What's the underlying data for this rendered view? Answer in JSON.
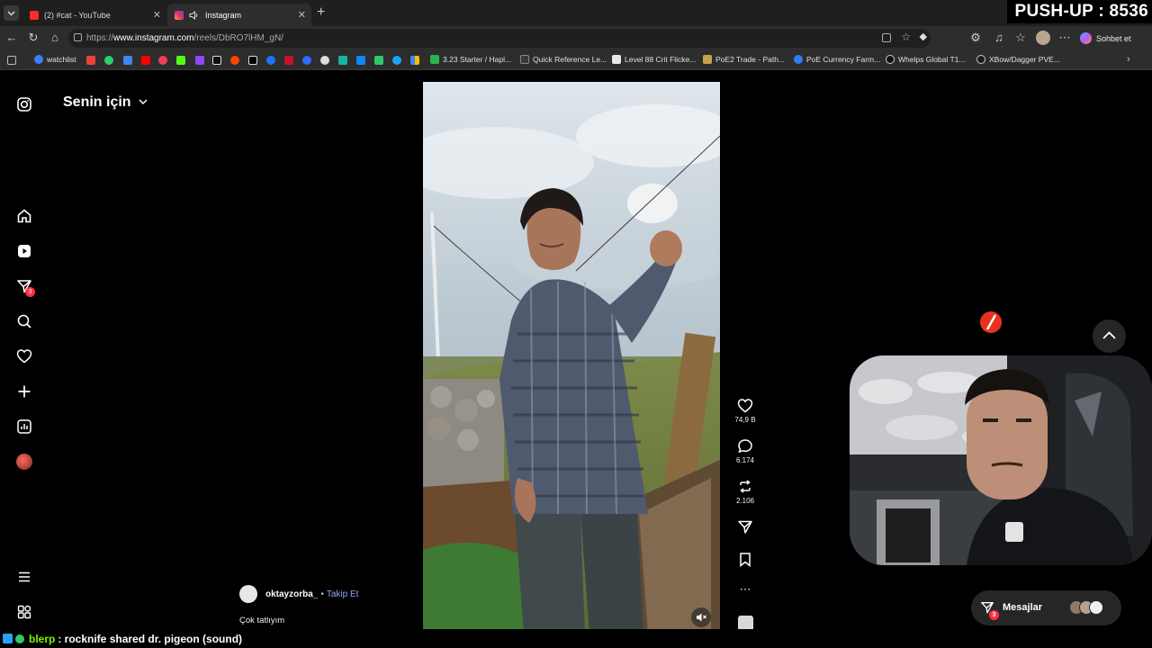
{
  "browser": {
    "tabs": [
      {
        "title": "(2) #cat - YouTube",
        "favicon": "youtube-icon",
        "active": false
      },
      {
        "title": "Instagram",
        "favicon": "instagram-icon",
        "active": true
      }
    ],
    "new_tab_symbol": "+",
    "address": {
      "prefix": "https://",
      "host": "www.instagram.com",
      "path": "/reels/DbRO7lHM_gN/"
    },
    "profile_button_label": "Sohbet et"
  },
  "overlay": {
    "pushup_counter": "PUSH-UP : 8536"
  },
  "bookmarks": [
    {
      "label": "watchlist",
      "color": "#3d7eff"
    },
    {
      "label": "3.23 Starter / Hapl...",
      "color": "#2bb34a"
    },
    {
      "label": "Quick Reference Le...",
      "color": "#3a3a3a"
    },
    {
      "label": "Level 88 Crit Flicke...",
      "color": "#e8e8e8"
    },
    {
      "label": "PoE2 Trade - Path...",
      "color": "#c9a24b"
    },
    {
      "label": "PoE Currency Farm...",
      "color": "#2f7df0"
    },
    {
      "label": "Whelps Global T1...",
      "color": "#111111"
    },
    {
      "label": "XBow/Dagger PVE...",
      "color": "#1b1b1b"
    }
  ],
  "instagram": {
    "feed_title": "Senin için",
    "notification_count": "3",
    "actions": {
      "likes": "74,9 B",
      "comments": "6.174",
      "reposts": "2.106"
    },
    "author": {
      "username": "oktayzorba_",
      "separator": "•",
      "follow_label": "Takip Et"
    },
    "caption": "Çok tatlıyım",
    "messages_label": "Mesajlar",
    "messages_badge": "3"
  },
  "chat": {
    "username": "blerp",
    "message": ": rocknife shared dr. pigeon (sound)"
  },
  "colors": {
    "accent": "#ff3040",
    "link": "#8ea6ff",
    "chat_user": "#7cf000"
  }
}
